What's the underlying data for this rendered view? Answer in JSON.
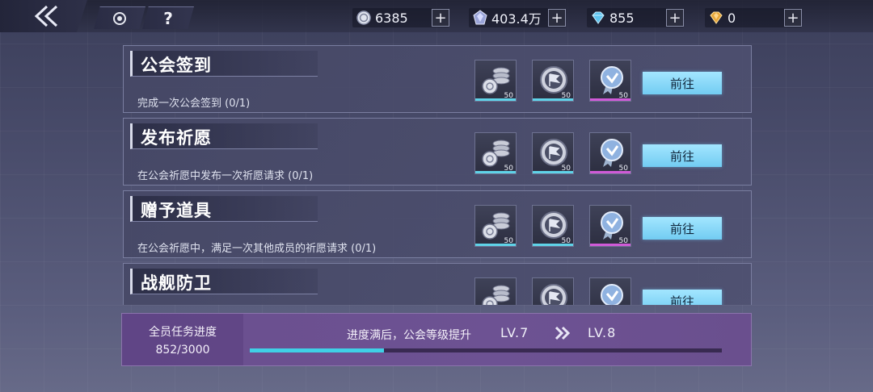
{
  "header": {
    "currencies": [
      {
        "name": "coin-icon",
        "value": "6385"
      },
      {
        "name": "crystal-icon",
        "value": "403.4万"
      },
      {
        "name": "diamond-icon",
        "value": "855"
      },
      {
        "name": "gem-icon",
        "value": "0"
      }
    ],
    "plus_label": "+",
    "help_label": "?"
  },
  "tasks": [
    {
      "title": "公会签到",
      "desc": "完成一次公会签到 (0/1)",
      "go": "前往"
    },
    {
      "title": "发布祈愿",
      "desc": "在公会祈愿中发布一次祈愿请求 (0/1)",
      "go": "前往"
    },
    {
      "title": "赠予道具",
      "desc": "在公会祈愿中，满足一次其他成员的祈愿请求 (0/1)",
      "go": "前往"
    },
    {
      "title": "战舰防卫",
      "desc": "",
      "go": "前往"
    }
  ],
  "rewards": [
    {
      "icon": "coins-stack-icon",
      "count": "50",
      "accent": "#5fd3e8"
    },
    {
      "icon": "flag-badge-icon",
      "count": "50",
      "accent": "#5fd3e8"
    },
    {
      "icon": "medal-icon",
      "count": "50",
      "accent": "#d05ad8"
    }
  ],
  "footer": {
    "label": "全员任务进度",
    "count": "852/3000",
    "progress": 0.284,
    "note": "进度满后，公会等级提升",
    "level_current": "LV.7",
    "level_next": "LV.8"
  },
  "colors": {
    "accent_cyan": "#3fd0e6",
    "go_button": "#8fdcfb",
    "footer_purple": "#6d5293"
  }
}
